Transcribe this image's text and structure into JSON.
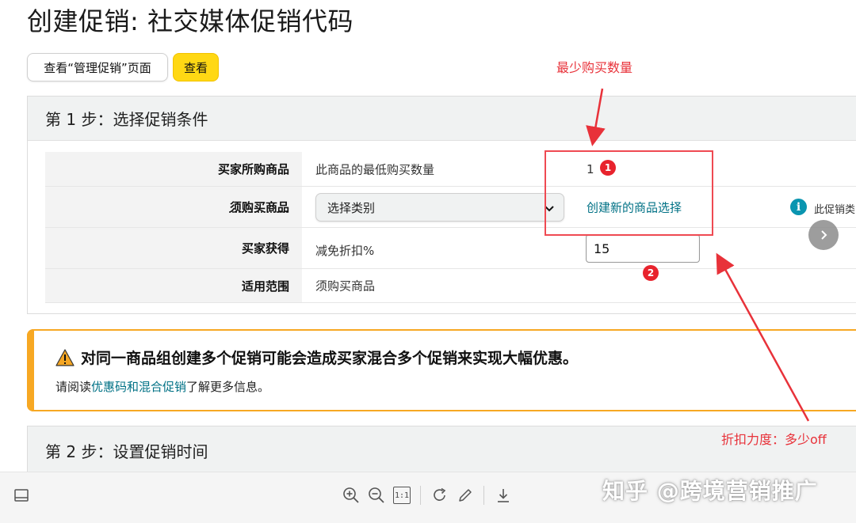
{
  "page": {
    "title": "创建促销: 社交媒体促销代码"
  },
  "toolbar": {
    "manage_label": "查看“管理促销”页面",
    "view_label": "查看"
  },
  "step1": {
    "header": "第 1 步：选择促销条件",
    "rows": [
      {
        "label": "买家所购商品",
        "value": "此商品的最低购买数量",
        "input_value": "1"
      },
      {
        "label": "须购买商品",
        "select_value": "选择类别",
        "link": "创建新的商品选择",
        "info_text": "此促销类"
      },
      {
        "label": "买家获得",
        "value": "减免折扣%",
        "input_value": "15"
      },
      {
        "label": "适用范围",
        "value": "须购买商品"
      }
    ]
  },
  "warning": {
    "title": "对同一商品组创建多个促销可能会造成买家混合多个促销来实现大幅优惠。",
    "body_prefix": "请阅读",
    "body_link": "优惠码和混合促销",
    "body_suffix": "了解更多信息。"
  },
  "step2": {
    "header": "第 2 步：设置促销时间"
  },
  "annotations": {
    "min_qty": "最少购买数量",
    "discount": "折扣力度：多少off",
    "badge1": "1",
    "badge2": "2",
    "color": "#e8323a"
  },
  "viewer": {
    "zoom_in_icon": "zoom-in-icon",
    "zoom_out_icon": "zoom-out-icon",
    "actual_size_label": "1:1",
    "rotate_icon": "rotate-icon",
    "edit_icon": "pencil-icon",
    "download_icon": "download-icon",
    "watermark": "知乎 @跨境营销推广"
  },
  "colors": {
    "accent_button": "#ffd814",
    "link": "#007185",
    "warning": "#f7a823",
    "info": "#0a95b0"
  }
}
